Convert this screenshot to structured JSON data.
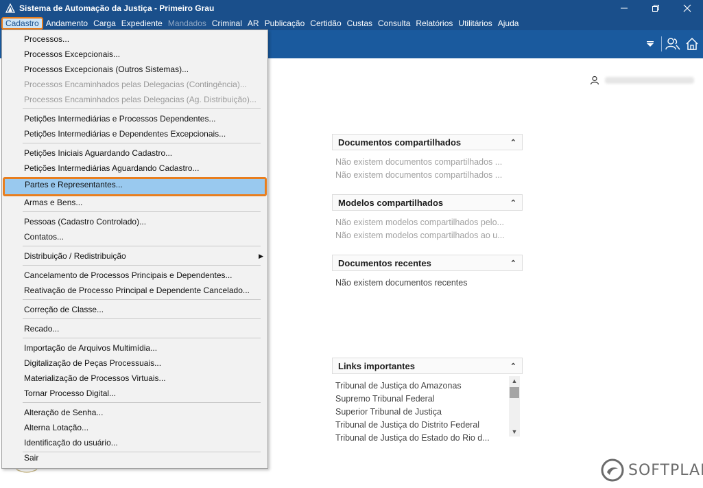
{
  "window": {
    "title": "Sistema de Automação da Justiça - Primeiro Grau",
    "controls": [
      "minimize",
      "restore",
      "close"
    ]
  },
  "menubar": [
    {
      "label": "Cadastro",
      "active": true
    },
    {
      "label": "Andamento"
    },
    {
      "label": "Carga"
    },
    {
      "label": "Expediente"
    },
    {
      "label": "Mandados",
      "disabled": true
    },
    {
      "label": "Criminal"
    },
    {
      "label": "AR"
    },
    {
      "label": "Publicação"
    },
    {
      "label": "Certidão"
    },
    {
      "label": "Custas"
    },
    {
      "label": "Consulta"
    },
    {
      "label": "Relatórios"
    },
    {
      "label": "Utilitários"
    },
    {
      "label": "Ajuda"
    }
  ],
  "dropdown": {
    "items": [
      {
        "label": "Processos..."
      },
      {
        "label": "Processos Excepcionais..."
      },
      {
        "label": "Processos Excepcionais (Outros Sistemas)..."
      },
      {
        "label": "Processos Encaminhados pelas Delegacias (Contingência)...",
        "disabled": true
      },
      {
        "label": "Processos Encaminhados pelas Delegacias (Ag. Distribuição)...",
        "disabled": true
      },
      {
        "label": "Petições Intermediárias e Processos Dependentes..."
      },
      {
        "label": "Petições Intermediárias e Dependentes Excepcionais..."
      },
      {
        "label": "Petições Iniciais Aguardando Cadastro..."
      },
      {
        "label": "Petições Intermediárias Aguardando Cadastro..."
      },
      {
        "label": "Partes e Representantes...",
        "highlighted": true
      },
      {
        "label": "Armas e Bens..."
      },
      {
        "label": "Pessoas (Cadastro Controlado)..."
      },
      {
        "label": "Contatos..."
      },
      {
        "label": "Distribuição / Redistribuição",
        "submenu": true
      },
      {
        "label": "Cancelamento de Processos Principais e Dependentes..."
      },
      {
        "label": "Reativação de Processo Principal e Dependente Cancelado..."
      },
      {
        "label": "Correção de Classe..."
      },
      {
        "label": "Recado..."
      },
      {
        "label": "Importação de Arquivos Multimídia..."
      },
      {
        "label": "Digitalização de Peças Processuais..."
      },
      {
        "label": "Materialização de Processos Virtuais..."
      },
      {
        "label": "Tornar Processo Digital..."
      },
      {
        "label": "Alteração de Senha..."
      },
      {
        "label": "Alterna Lotação..."
      },
      {
        "label": "Identificação do usuário..."
      },
      {
        "label": "Sair"
      }
    ]
  },
  "panels": {
    "docs_compartilhados": {
      "title": "Documentos compartilhados",
      "lines": [
        "Não existem documentos compartilhados ...",
        "Não existem documentos compartilhados ..."
      ]
    },
    "modelos_compartilhados": {
      "title": "Modelos compartilhados",
      "lines": [
        "Não existem modelos compartilhados pelo...",
        "Não existem modelos compartilhados ao u..."
      ]
    },
    "docs_recentes": {
      "title": "Documentos recentes",
      "lines": [
        "Não existem documentos recentes"
      ]
    },
    "links": {
      "title": "Links importantes",
      "items": [
        "Tribunal de Justiça do Amazonas",
        "Supremo Tribunal Federal",
        "Superior Tribunal de Justiça",
        "Tribunal de Justiça do Distrito Federal",
        "Tribunal de Justiça do Estado do Rio d..."
      ]
    }
  },
  "brand": {
    "logo_text": "SOFTPLAN"
  },
  "colors": {
    "titlebar": "#1a4f8b",
    "toolbar": "#1a5a9e",
    "highlight": "#99c9ef",
    "accent_outline": "#e87e1e"
  }
}
